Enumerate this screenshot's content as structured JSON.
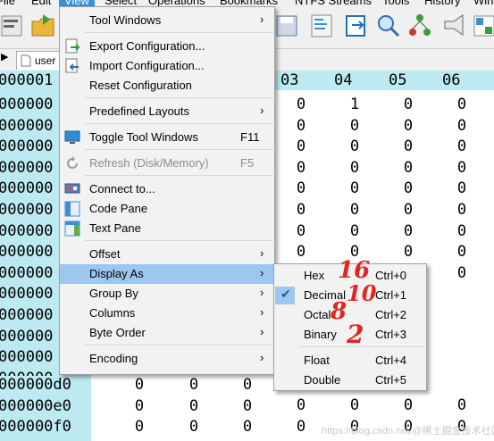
{
  "menubar": {
    "items": [
      "File",
      "Edit",
      "View",
      "Select",
      "Operations",
      "Bookmarks",
      "NTFS Streams",
      "Tools",
      "History",
      "Win"
    ],
    "active": "View"
  },
  "tab": {
    "label": "user"
  },
  "grid": {
    "top_address": "000001",
    "column_headers": [
      "03",
      "04",
      "05",
      "06"
    ],
    "addresses_partial": [
      "000000",
      "000000",
      "000000",
      "000000",
      "000000",
      "000000",
      "000000",
      "000000",
      "000000",
      "000000",
      "000000",
      "000000",
      "000000",
      "000000"
    ],
    "bottom_addresses": [
      "000000d0",
      "000000e0",
      "000000f0"
    ],
    "rows_right": [
      [
        "0",
        "1",
        "0",
        "0"
      ],
      [
        "0",
        "0",
        "0",
        "0"
      ],
      [
        "0",
        "0",
        "0",
        "0"
      ],
      [
        "0",
        "0",
        "0",
        "0"
      ],
      [
        "0",
        "0",
        "0",
        "0"
      ],
      [
        "0",
        "0",
        "0",
        "0"
      ],
      [
        "0",
        "0",
        "0",
        "0"
      ],
      [
        "0",
        "0",
        "0",
        "0"
      ],
      [
        "0",
        "0",
        "0",
        "0"
      ]
    ],
    "bottom_rows_left": [
      [
        "0",
        "0",
        "0"
      ],
      [
        "0",
        "0",
        "0"
      ],
      [
        "0",
        "0",
        "0"
      ]
    ],
    "bottom_rows_right": [
      [
        "0",
        "0",
        "0",
        "0"
      ],
      [
        "0",
        "0",
        "0",
        "0"
      ]
    ]
  },
  "view_menu": {
    "tool_windows": "Tool Windows",
    "export_configuration": "Export Configuration...",
    "import_configuration": "Import Configuration...",
    "reset_configuration": "Reset Configuration",
    "predefined_layouts": "Predefined Layouts",
    "toggle_tool_windows": "Toggle Tool Windows",
    "toggle_tool_windows_shortcut": "F11",
    "refresh": "Refresh (Disk/Memory)",
    "refresh_shortcut": "F5",
    "connect_to": "Connect to...",
    "code_pane": "Code Pane",
    "text_pane": "Text Pane",
    "offset": "Offset",
    "display_as": "Display As",
    "group_by": "Group By",
    "columns": "Columns",
    "byte_order": "Byte Order",
    "encoding": "Encoding"
  },
  "display_as_submenu": {
    "items": [
      {
        "label": "Hex",
        "shortcut": "Ctrl+0"
      },
      {
        "label": "Decimal",
        "shortcut": "Ctrl+1",
        "checked": true
      },
      {
        "label": "Octal",
        "shortcut": "Ctrl+2"
      },
      {
        "label": "Binary",
        "shortcut": "Ctrl+3"
      },
      {
        "label": "Float",
        "shortcut": "Ctrl+4"
      },
      {
        "label": "Double",
        "shortcut": "Ctrl+5"
      }
    ]
  },
  "annotations": {
    "hex": "16",
    "decimal": "10",
    "octal": "8",
    "binary": "2"
  },
  "watermark": "https://blog.csdn.net/@稀土掘金技术社区",
  "colors": {
    "accent": "#3b8fd6",
    "highlight": "#9cc8ef",
    "grid_header": "#bdeaf1",
    "annotation": "#e0261f"
  }
}
